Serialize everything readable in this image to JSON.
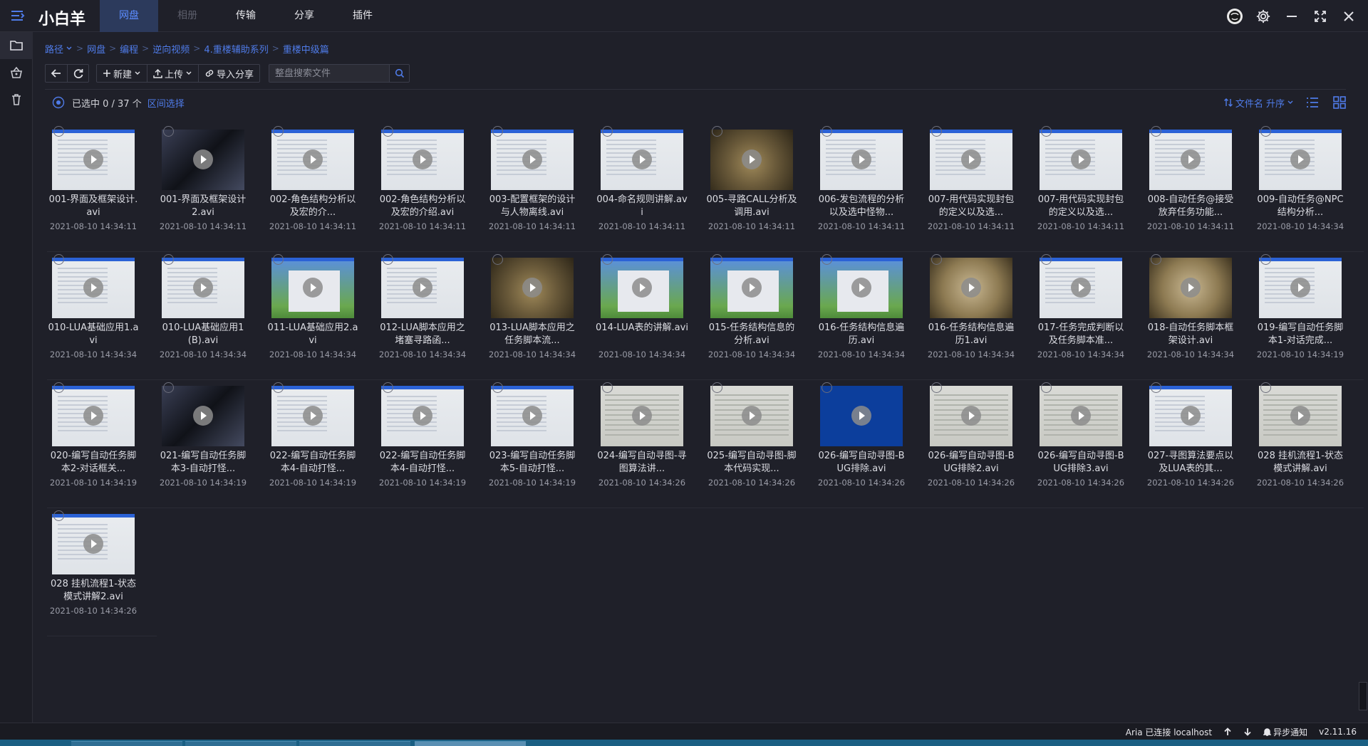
{
  "app": {
    "title": "小白羊"
  },
  "nav": {
    "tabs": [
      {
        "label": "网盘",
        "state": "active"
      },
      {
        "label": "相册",
        "state": "dim"
      },
      {
        "label": "传输",
        "state": "normal"
      },
      {
        "label": "分享",
        "state": "normal"
      },
      {
        "label": "插件",
        "state": "normal"
      }
    ]
  },
  "breadcrumb": {
    "items": [
      "路径",
      "网盘",
      "编程",
      "逆向视频",
      "4.重楼辅助系列",
      "重楼中级篇"
    ]
  },
  "toolbar": {
    "new_label": "新建",
    "upload_label": "上传",
    "import_label": "导入分享",
    "search_placeholder": "整盘搜索文件"
  },
  "selection": {
    "count_text": "已选中 0 / 37 个",
    "range_label": "区间选择"
  },
  "sort": {
    "label": "文件名 升序"
  },
  "files": [
    {
      "name": "001-界面及框架设计.avi",
      "date": "2021-08-10 14:34:11",
      "thumb": "win"
    },
    {
      "name": "001-界面及框架设计2.avi",
      "date": "2021-08-10 14:34:11",
      "thumb": "dark"
    },
    {
      "name": "002-角色结构分析以及宏的介...",
      "date": "2021-08-10 14:34:11",
      "thumb": "win"
    },
    {
      "name": "002-角色结构分析以及宏的介绍.avi",
      "date": "2021-08-10 14:34:11",
      "thumb": "win"
    },
    {
      "name": "003-配置框架的设计与人物离线.avi",
      "date": "2021-08-10 14:34:11",
      "thumb": "win"
    },
    {
      "name": "004-命名规则讲解.avi",
      "date": "2021-08-10 14:34:11",
      "thumb": "win"
    },
    {
      "name": "005-寻路CALL分析及调用.avi",
      "date": "2021-08-10 14:34:11",
      "thumb": "game"
    },
    {
      "name": "006-发包流程的分析以及选中怪物...",
      "date": "2021-08-10 14:34:11",
      "thumb": "win"
    },
    {
      "name": "007-用代码实现封包的定义以及选...",
      "date": "2021-08-10 14:34:11",
      "thumb": "win"
    },
    {
      "name": "007-用代码实现封包的定义以及选...",
      "date": "2021-08-10 14:34:11",
      "thumb": "win"
    },
    {
      "name": "008-自动任务@接受放弃任务功能...",
      "date": "2021-08-10 14:34:11",
      "thumb": "win"
    },
    {
      "name": "009-自动任务@NPC结构分析...",
      "date": "2021-08-10 14:34:34",
      "thumb": "win"
    },
    {
      "name": "010-LUA基础应用1.avi",
      "date": "2021-08-10 14:34:34",
      "thumb": "win"
    },
    {
      "name": "010-LUA基础应用1(B).avi",
      "date": "2021-08-10 14:34:34",
      "thumb": "win"
    },
    {
      "name": "011-LUA基础应用2.avi",
      "date": "2021-08-10 14:34:34",
      "thumb": "xp"
    },
    {
      "name": "012-LUA脚本应用之堵塞寻路函...",
      "date": "2021-08-10 14:34:34",
      "thumb": "win"
    },
    {
      "name": "013-LUA脚本应用之任务脚本流...",
      "date": "2021-08-10 14:34:34",
      "thumb": "game"
    },
    {
      "name": "014-LUA表的讲解.avi",
      "date": "2021-08-10 14:34:34",
      "thumb": "xp"
    },
    {
      "name": "015-任务结构信息的分析.avi",
      "date": "2021-08-10 14:34:34",
      "thumb": "xp"
    },
    {
      "name": "016-任务结构信息遍历.avi",
      "date": "2021-08-10 14:34:34",
      "thumb": "xp"
    },
    {
      "name": "016-任务结构信息遍历1.avi",
      "date": "2021-08-10 14:34:34",
      "thumb": "book"
    },
    {
      "name": "017-任务完成判断以及任务脚本准...",
      "date": "2021-08-10 14:34:34",
      "thumb": "win"
    },
    {
      "name": "018-自动任务脚本框架设计.avi",
      "date": "2021-08-10 14:34:34",
      "thumb": "book"
    },
    {
      "name": "019-编写自动任务脚本1-对话完成...",
      "date": "2021-08-10 14:34:19",
      "thumb": "win"
    },
    {
      "name": "020-编写自动任务脚本2-对话框关...",
      "date": "2021-08-10 14:34:19",
      "thumb": "win"
    },
    {
      "name": "021-编写自动任务脚本3-自动打怪...",
      "date": "2021-08-10 14:34:19",
      "thumb": "dark"
    },
    {
      "name": "022-编写自动任务脚本4-自动打怪...",
      "date": "2021-08-10 14:34:19",
      "thumb": "win"
    },
    {
      "name": "022-编写自动任务脚本4-自动打怪...",
      "date": "2021-08-10 14:34:19",
      "thumb": "win"
    },
    {
      "name": "023-编写自动任务脚本5-自动打怪...",
      "date": "2021-08-10 14:34:19",
      "thumb": "win"
    },
    {
      "name": "024-编写自动寻图-寻图算法讲...",
      "date": "2021-08-10 14:34:26",
      "thumb": "gray"
    },
    {
      "name": "025-编写自动寻图-脚本代码实现...",
      "date": "2021-08-10 14:34:26",
      "thumb": "gray"
    },
    {
      "name": "026-编写自动寻图-BUG排除.avi",
      "date": "2021-08-10 14:34:26",
      "thumb": "blue"
    },
    {
      "name": "026-编写自动寻图-BUG排除2.avi",
      "date": "2021-08-10 14:34:26",
      "thumb": "gray"
    },
    {
      "name": "026-编写自动寻图-BUG排除3.avi",
      "date": "2021-08-10 14:34:26",
      "thumb": "gray"
    },
    {
      "name": "027-寻图算法要点以及LUA表的其...",
      "date": "2021-08-10 14:34:26",
      "thumb": "win"
    },
    {
      "name": "028 挂机流程1-状态模式讲解.avi",
      "date": "2021-08-10 14:34:26",
      "thumb": "gray"
    },
    {
      "name": "028 挂机流程1-状态模式讲解2.avi",
      "date": "2021-08-10 14:34:26",
      "thumb": "win"
    }
  ],
  "status": {
    "aria_text": "Aria 已连接 localhost",
    "notify_label": "异步通知",
    "version": "v2.11.16"
  },
  "colors": {
    "accent": "#4f7be8",
    "background": "#1f2029",
    "active_tab_bg": "#2c3a5c"
  }
}
